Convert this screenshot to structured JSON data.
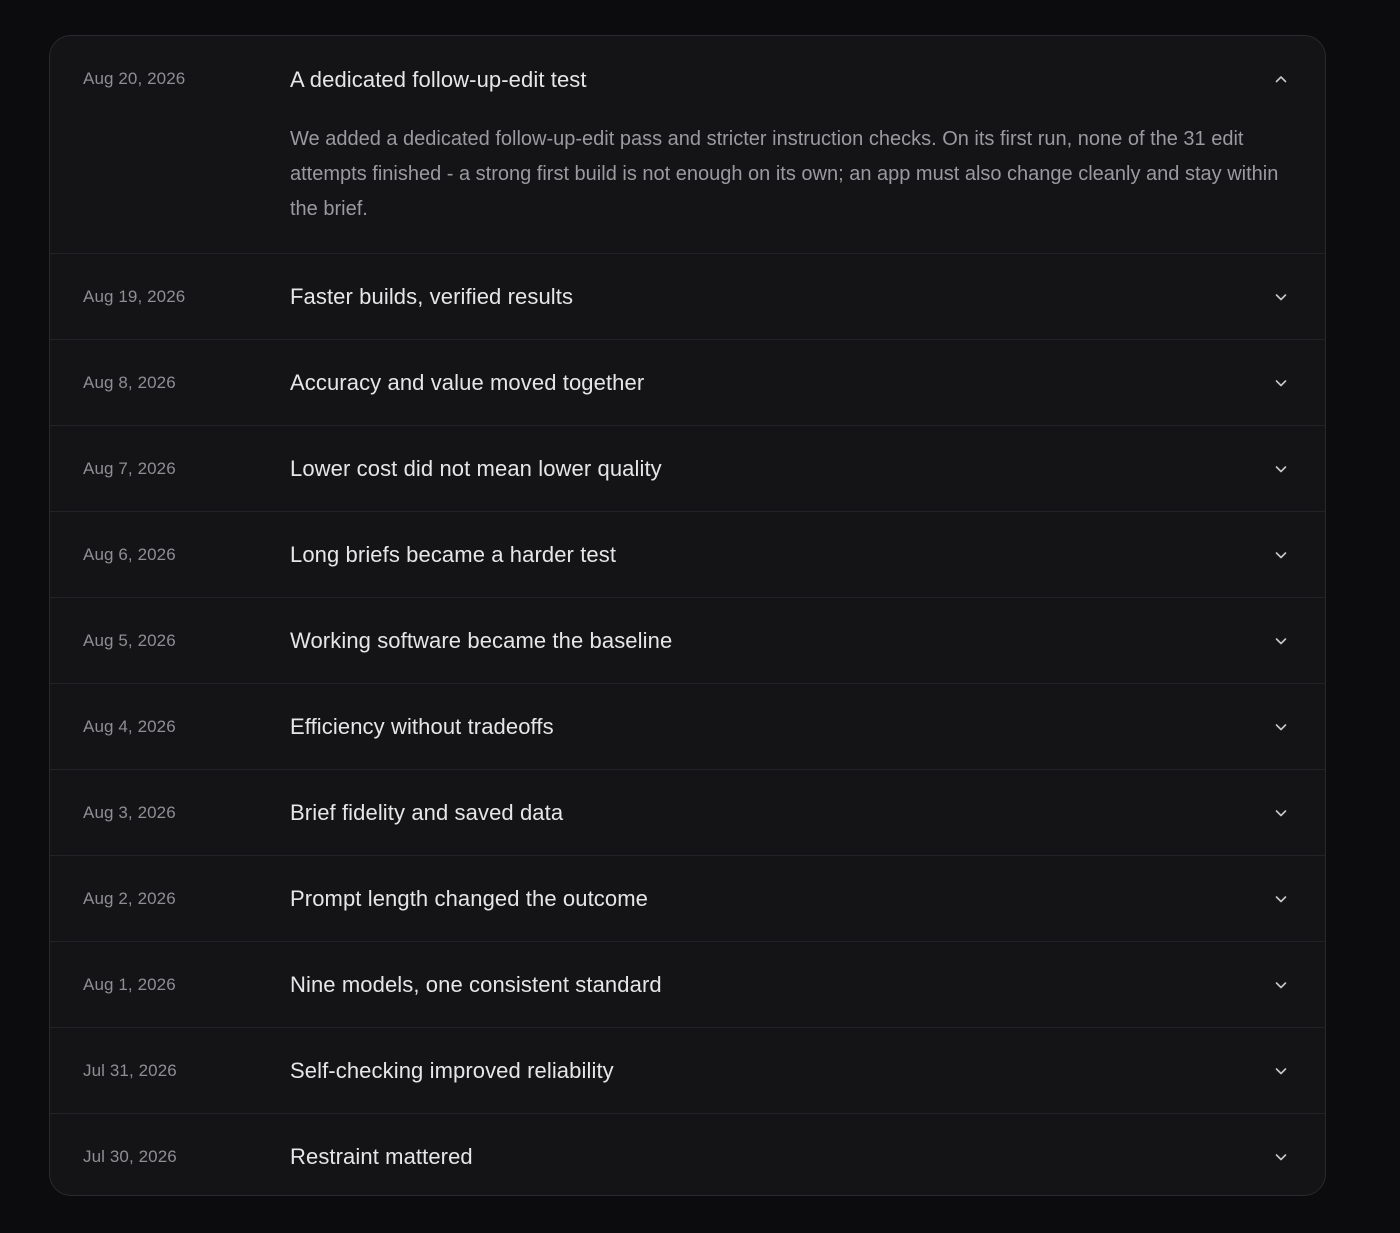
{
  "entries": [
    {
      "date": "Aug 20, 2026",
      "title": "A dedicated follow-up-edit test",
      "expanded": true,
      "body": "We added a dedicated follow-up-edit pass and stricter instruction checks. On its first run, none of the 31 edit attempts finished - a strong first build is not enough on its own; an app must also change cleanly and stay within the brief.",
      "toggle_icon": "chevron-up-icon"
    },
    {
      "date": "Aug 19, 2026",
      "title": "Faster builds, verified results",
      "expanded": false,
      "toggle_icon": "chevron-down-icon"
    },
    {
      "date": "Aug 8, 2026",
      "title": "Accuracy and value moved together",
      "expanded": false,
      "toggle_icon": "chevron-down-icon"
    },
    {
      "date": "Aug 7, 2026",
      "title": "Lower cost did not mean lower quality",
      "expanded": false,
      "toggle_icon": "chevron-down-icon"
    },
    {
      "date": "Aug 6, 2026",
      "title": "Long briefs became a harder test",
      "expanded": false,
      "toggle_icon": "chevron-down-icon"
    },
    {
      "date": "Aug 5, 2026",
      "title": "Working software became the baseline",
      "expanded": false,
      "toggle_icon": "chevron-down-icon"
    },
    {
      "date": "Aug 4, 2026",
      "title": "Efficiency without tradeoffs",
      "expanded": false,
      "toggle_icon": "chevron-down-icon"
    },
    {
      "date": "Aug 3, 2026",
      "title": "Brief fidelity and saved data",
      "expanded": false,
      "toggle_icon": "chevron-down-icon"
    },
    {
      "date": "Aug 2, 2026",
      "title": "Prompt length changed the outcome",
      "expanded": false,
      "toggle_icon": "chevron-down-icon"
    },
    {
      "date": "Aug 1, 2026",
      "title": "Nine models, one consistent standard",
      "expanded": false,
      "toggle_icon": "chevron-down-icon"
    },
    {
      "date": "Jul 31, 2026",
      "title": "Self-checking improved reliability",
      "expanded": false,
      "toggle_icon": "chevron-down-icon"
    },
    {
      "date": "Jul 30, 2026",
      "title": "Restraint mattered",
      "expanded": false,
      "toggle_icon": "chevron-down-icon"
    }
  ],
  "colors": {
    "page_background": "#0c0c0e",
    "panel_background": "#141416",
    "title_text": "#e6e6e8",
    "muted_text": "#8e8e93"
  }
}
